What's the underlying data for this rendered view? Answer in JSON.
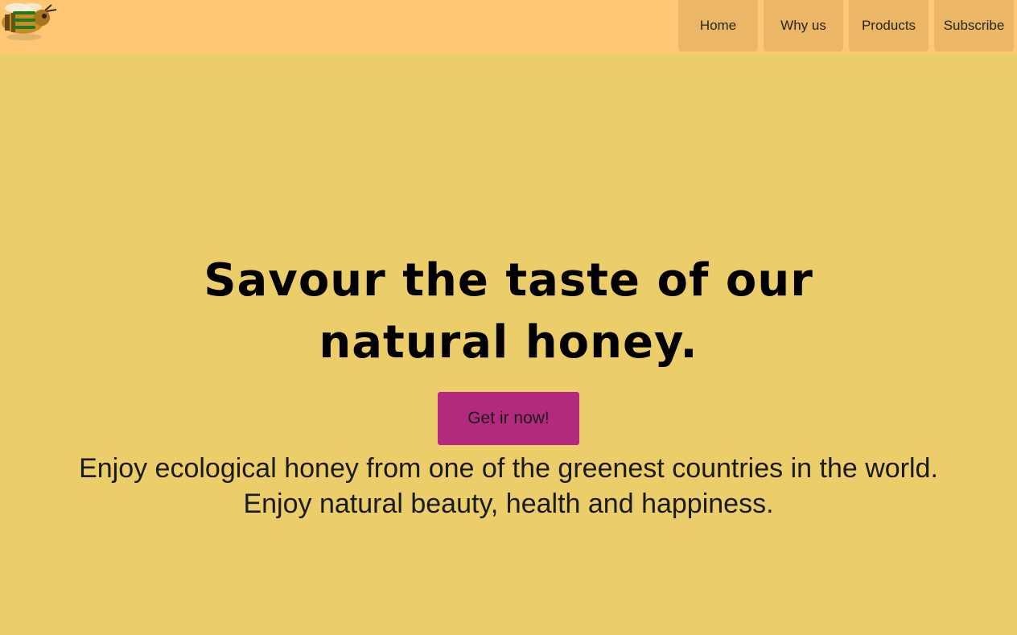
{
  "header": {
    "logo_icon": "bee-logo-icon",
    "menu_icon": "hamburger-menu-icon",
    "nav_items": [
      {
        "label": "Home"
      },
      {
        "label": "Why us"
      },
      {
        "label": "Products"
      },
      {
        "label": "Subscribe"
      }
    ]
  },
  "hero": {
    "title": "Savour the taste of our natural honey.",
    "cta_label": "Get ir now!",
    "tagline": "Enjoy ecological honey from one of the greenest countries in the world. Enjoy natural beauty, health and happiness."
  },
  "colors": {
    "header_bg": "#ffc774",
    "page_bg": "#ebcd6a",
    "nav_item_bg": "#ebb766",
    "cta_bg": "#b22a7e",
    "menu_icon": "#1f7a1f"
  }
}
